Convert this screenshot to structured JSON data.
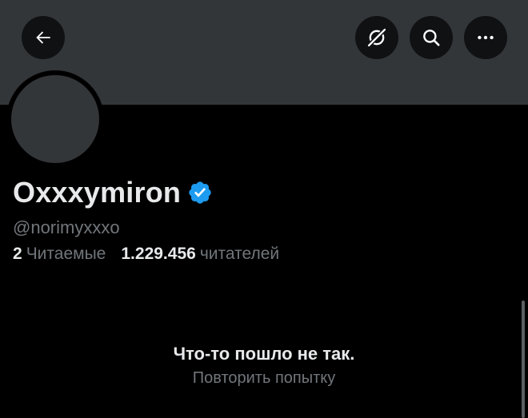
{
  "header": {
    "back_icon": "arrow-left-icon",
    "grok_icon": "grok-icon",
    "search_icon": "search-icon",
    "more_icon": "more-horizontal-icon"
  },
  "profile": {
    "display_name": "Oxxxymiron",
    "verified_icon": "verified-badge-icon",
    "verified_color": "#1d9bf0",
    "handle": "@norimyxxxo",
    "following_count": "2",
    "following_label": "Читаемые",
    "followers_count": "1.229.456",
    "followers_label": "читателей"
  },
  "error": {
    "title": "Что-то пошло не так.",
    "retry_label": "Повторить попытку"
  },
  "colors": {
    "background": "#000000",
    "banner": "#333639",
    "primary_text": "#e7e9ea",
    "secondary_text": "#71767b",
    "accent": "#1d9bf0"
  }
}
